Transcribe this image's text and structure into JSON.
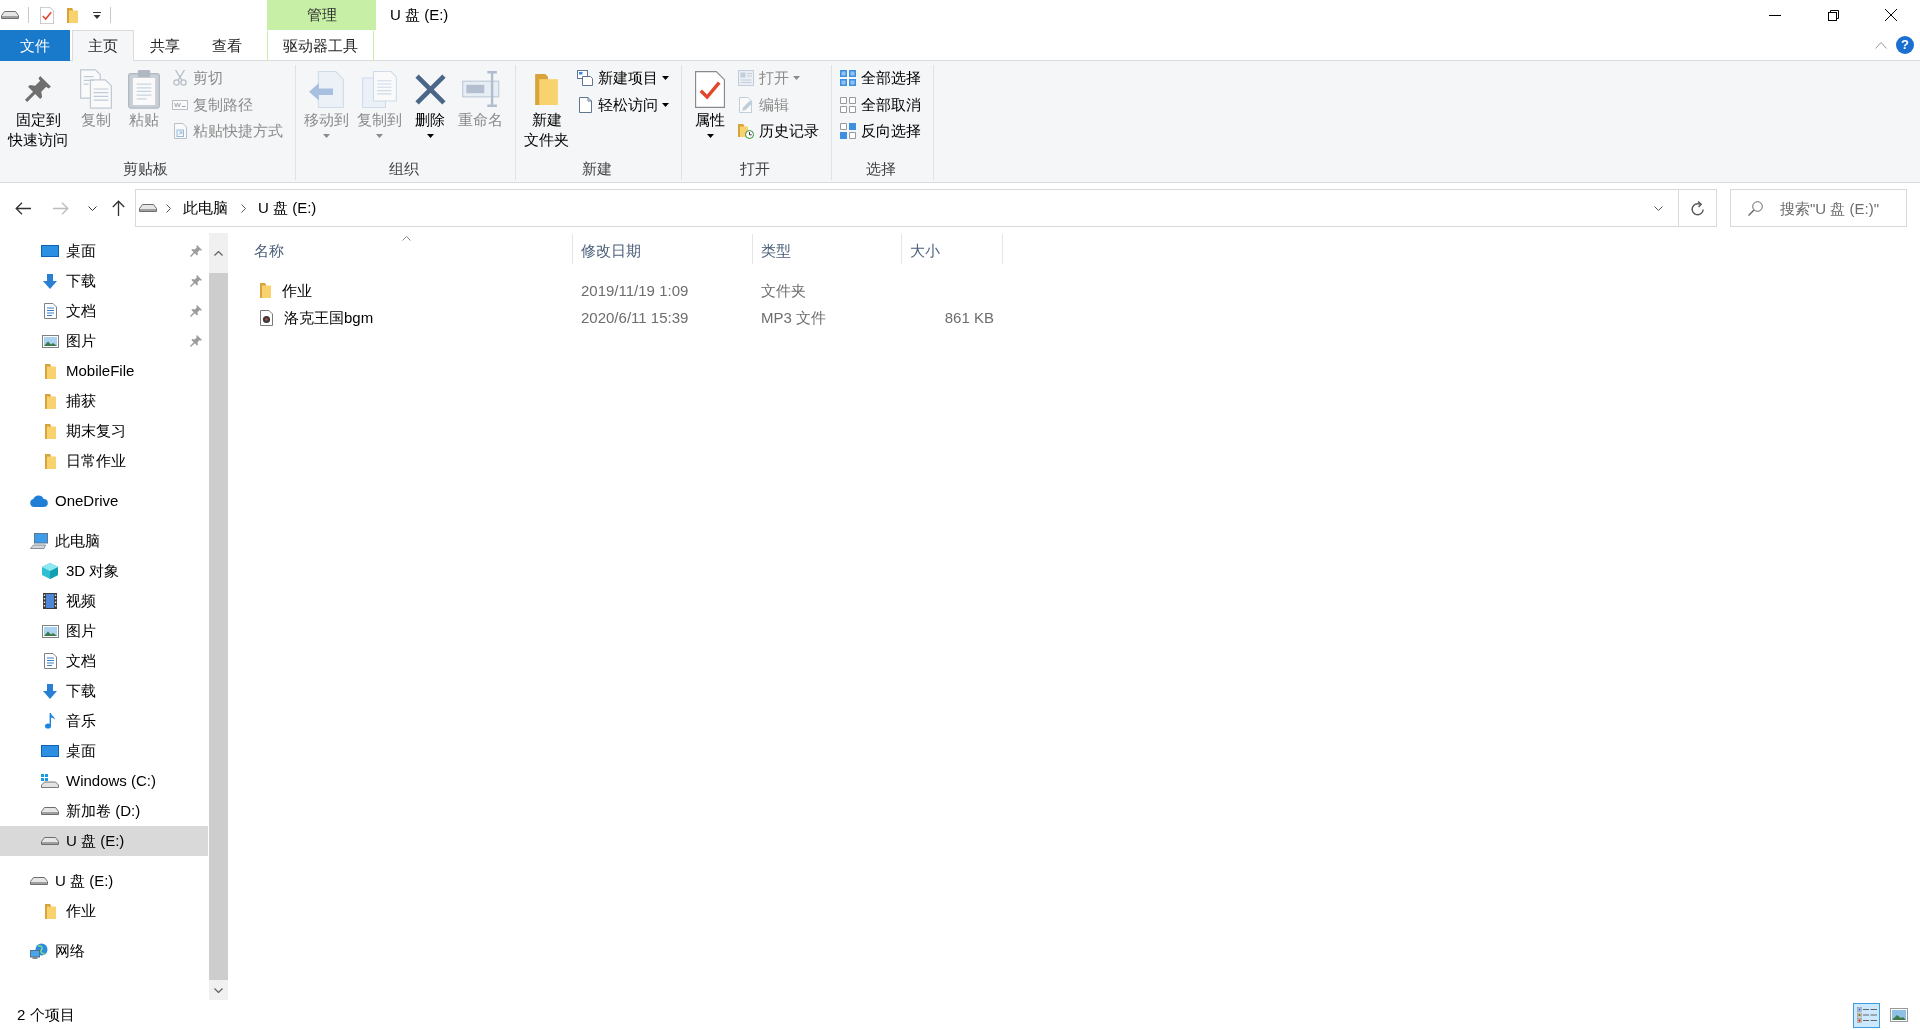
{
  "window": {
    "title": "U 盘 (E:)",
    "context_group": "管理"
  },
  "ribbon": {
    "tabs": [
      {
        "label": "文件",
        "kind": "file",
        "selected": false
      },
      {
        "label": "主页",
        "kind": "normal",
        "selected": true
      },
      {
        "label": "共享",
        "kind": "normal",
        "selected": false
      },
      {
        "label": "查看",
        "kind": "normal",
        "selected": false
      },
      {
        "label": "驱动器工具",
        "kind": "context",
        "selected": false
      }
    ],
    "help_label": "?",
    "groups": [
      {
        "label": "剪贴板",
        "buttons": [
          {
            "kind": "pin",
            "lines": [
              "固定到",
              "快速访问"
            ],
            "large": true,
            "disabled": false,
            "dropdown": false
          },
          {
            "kind": "copy",
            "label": "复制",
            "large": true,
            "disabled": true,
            "dropdown": false
          },
          {
            "kind": "paste",
            "label": "粘贴",
            "large": true,
            "disabled": true,
            "dropdown": false
          },
          {
            "kind": "cut",
            "label": "剪切",
            "large": false,
            "disabled": true,
            "dropdown": false
          },
          {
            "kind": "copy-path",
            "label": "复制路径",
            "large": false,
            "disabled": true,
            "dropdown": false
          },
          {
            "kind": "paste-shortcut",
            "label": "粘贴快捷方式",
            "large": false,
            "disabled": true,
            "dropdown": false
          }
        ]
      },
      {
        "label": "组织",
        "buttons": [
          {
            "kind": "move-to",
            "label": "移动到",
            "large": true,
            "disabled": true,
            "dropdown": true
          },
          {
            "kind": "copy-to",
            "label": "复制到",
            "large": true,
            "disabled": true,
            "dropdown": true
          },
          {
            "kind": "delete",
            "label": "删除",
            "large": true,
            "disabled": false,
            "dropdown": true
          },
          {
            "kind": "rename",
            "label": "重命名",
            "large": true,
            "disabled": true,
            "dropdown": false
          }
        ]
      },
      {
        "label": "新建",
        "buttons": [
          {
            "kind": "new-folder",
            "lines": [
              "新建",
              "文件夹"
            ],
            "large": true,
            "disabled": false,
            "dropdown": false
          },
          {
            "kind": "new-item",
            "label": "新建项目",
            "large": false,
            "disabled": false,
            "dropdown": true
          },
          {
            "kind": "easy-access",
            "label": "轻松访问",
            "large": false,
            "disabled": false,
            "dropdown": true
          }
        ]
      },
      {
        "label": "打开",
        "buttons": [
          {
            "kind": "properties",
            "label": "属性",
            "large": true,
            "disabled": false,
            "dropdown": true
          },
          {
            "kind": "open",
            "label": "打开",
            "large": false,
            "disabled": true,
            "dropdown": true
          },
          {
            "kind": "edit",
            "label": "编辑",
            "large": false,
            "disabled": true,
            "dropdown": false
          },
          {
            "kind": "history",
            "label": "历史记录",
            "large": false,
            "disabled": false,
            "dropdown": false
          }
        ]
      },
      {
        "label": "选择",
        "buttons": [
          {
            "kind": "select-all",
            "label": "全部选择",
            "large": false,
            "disabled": false,
            "dropdown": false
          },
          {
            "kind": "select-none",
            "label": "全部取消",
            "large": false,
            "disabled": false,
            "dropdown": false
          },
          {
            "kind": "invert-selection",
            "label": "反向选择",
            "large": false,
            "disabled": false,
            "dropdown": false
          }
        ]
      }
    ]
  },
  "address_bar": {
    "nav_buttons": [
      {
        "kind": "back",
        "disabled": false
      },
      {
        "kind": "forward",
        "disabled": true
      },
      {
        "kind": "recent",
        "disabled": false
      },
      {
        "kind": "up",
        "disabled": false
      }
    ],
    "breadcrumbs": [
      "此电脑",
      "U 盘 (E:)"
    ],
    "search": {
      "placeholder": "搜索\"U 盘 (E:)\""
    }
  },
  "sidebar": {
    "items": [
      {
        "children": [
          {
            "label": "桌面",
            "kind": "desktop",
            "pinned": true,
            "selected": false
          },
          {
            "label": "下载",
            "kind": "download",
            "pinned": true,
            "selected": false
          },
          {
            "label": "文档",
            "kind": "documents",
            "pinned": true,
            "selected": false
          },
          {
            "label": "图片",
            "kind": "pictures",
            "pinned": true,
            "selected": false
          },
          {
            "label": "MobileFile",
            "kind": "folder",
            "pinned": false,
            "selected": false
          },
          {
            "label": "捕获",
            "kind": "folder",
            "pinned": false,
            "selected": false
          },
          {
            "label": "期末复习",
            "kind": "folder",
            "pinned": false,
            "selected": false
          },
          {
            "label": "日常作业",
            "kind": "folder",
            "pinned": false,
            "selected": false
          }
        ]
      },
      {
        "label": "OneDrive",
        "kind": "cloud",
        "pinned": false,
        "selected": false
      },
      {
        "label": "此电脑",
        "kind": "computer",
        "pinned": false,
        "selected": false,
        "children": [
          {
            "label": "3D 对象",
            "kind": "objects3d",
            "pinned": false,
            "selected": false
          },
          {
            "label": "视频",
            "kind": "videos",
            "pinned": false,
            "selected": false
          },
          {
            "label": "图片",
            "kind": "pictures",
            "pinned": false,
            "selected": false
          },
          {
            "label": "文档",
            "kind": "documents",
            "pinned": false,
            "selected": false
          },
          {
            "label": "下载",
            "kind": "download",
            "pinned": false,
            "selected": false
          },
          {
            "label": "音乐",
            "kind": "music",
            "pinned": false,
            "selected": false
          },
          {
            "label": "桌面",
            "kind": "desktop",
            "pinned": false,
            "selected": false
          },
          {
            "label": "Windows (C:)",
            "kind": "system-drive",
            "pinned": false,
            "selected": false
          },
          {
            "label": "新加卷 (D:)",
            "kind": "drive",
            "pinned": false,
            "selected": false
          },
          {
            "label": "U 盘 (E:)",
            "kind": "removable-drive",
            "pinned": false,
            "selected": true
          }
        ]
      },
      {
        "label": "U 盘 (E:)",
        "kind": "removable-drive",
        "pinned": false,
        "selected": false,
        "children": [
          {
            "label": "作业",
            "kind": "folder",
            "pinned": false,
            "selected": false
          }
        ]
      },
      {
        "label": "网络",
        "kind": "network",
        "pinned": false,
        "selected": false
      }
    ]
  },
  "file_list": {
    "columns": [
      {
        "label": "名称",
        "sorted": true
      },
      {
        "label": "修改日期",
        "sorted": false
      },
      {
        "label": "类型",
        "sorted": false
      },
      {
        "label": "大小",
        "sorted": false
      }
    ],
    "rows": [
      {
        "kind": "folder",
        "name": "作业",
        "modified": "2019/11/19 1:09",
        "type": "文件夹",
        "selected": false
      },
      {
        "kind": "audio",
        "name": "洛克王国bgm",
        "modified": "2020/6/11 15:39",
        "type": "MP3 文件",
        "size": "861 KB",
        "selected": false
      }
    ]
  },
  "status_bar": {
    "item_count": "2 个项目",
    "views": [
      {
        "kind": "details",
        "selected": true
      },
      {
        "kind": "large-icons",
        "selected": false
      }
    ]
  }
}
